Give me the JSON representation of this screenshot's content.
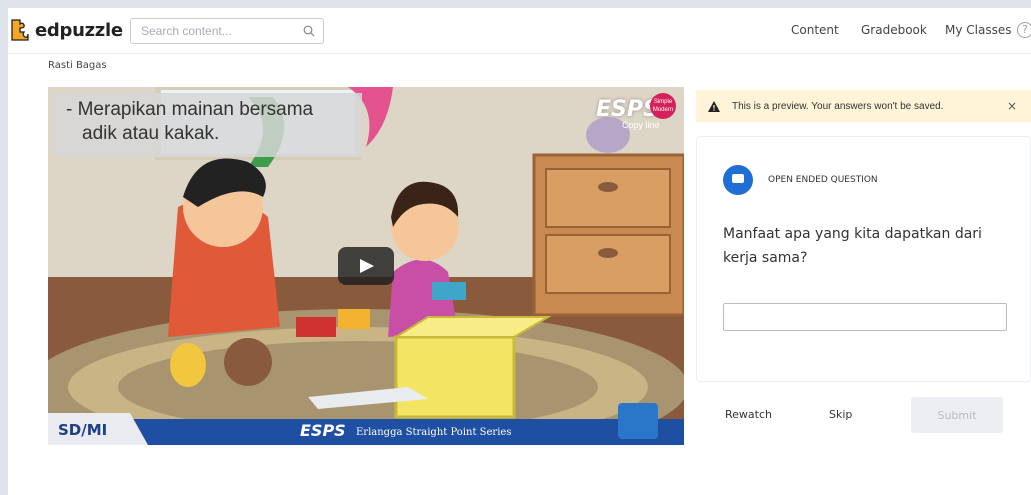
{
  "brand": {
    "name": "edpuzzle",
    "accent": "#f5a623"
  },
  "search": {
    "placeholder": "Search content..."
  },
  "nav": {
    "content": "Content",
    "gradebook": "Gradebook",
    "my_classes": "My Classes",
    "help": "?"
  },
  "student": {
    "name": "Rasti Bagas"
  },
  "video": {
    "caption_line1": "- Merapikan mainan bersama",
    "caption_line2": "adik atau kakak.",
    "brand_top": "ESPS",
    "brand_badge": "Simple Modern",
    "brand_sub": "Copy line",
    "footer_label": "SD/MI",
    "footer_brand": "ESPS",
    "footer_series": "Erlangga Straight Point Series"
  },
  "preview": {
    "message": "This is a preview. Your answers won't be saved.",
    "close": "×"
  },
  "question": {
    "type": "OPEN ENDED QUESTION",
    "text": "Manfaat apa yang kita dapatkan dari kerja sama?",
    "answer_value": ""
  },
  "actions": {
    "rewatch": "Rewatch",
    "skip": "Skip",
    "submit": "Submit"
  },
  "colors": {
    "primary": "#1e6ed6",
    "preview_bg": "#fff4d8",
    "footer_band": "#1e4fa2"
  }
}
